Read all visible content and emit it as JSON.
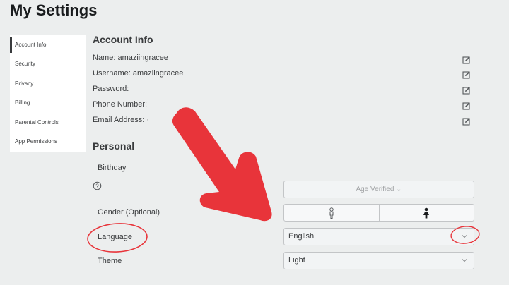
{
  "page": {
    "title": "My Settings"
  },
  "sidebar": {
    "items": [
      {
        "label": "Account Info"
      },
      {
        "label": "Security"
      },
      {
        "label": "Privacy"
      },
      {
        "label": "Billing"
      },
      {
        "label": "Parental Controls"
      },
      {
        "label": "App Permissions"
      }
    ]
  },
  "account_info": {
    "title": "Account Info",
    "name": "Name: amaziingracee",
    "username": "Username: amaziingracee",
    "password": "Password:",
    "phone": "Phone Number:",
    "email": "Email Address: ·"
  },
  "personal": {
    "title": "Personal",
    "birthday_label": "Birthday",
    "age_verified": "Age Verified ⌄",
    "gender_label": "Gender (Optional)",
    "language_label": "Language",
    "language_value": "English",
    "theme_label": "Theme",
    "theme_value": "Light"
  },
  "icons": {
    "edit": "pencil-edit-icon",
    "help": "question-circle-icon",
    "male": "male-user-icon",
    "female": "female-user-icon",
    "chevron": "chevron-down-icon"
  },
  "annotation_color": "#e8343a"
}
